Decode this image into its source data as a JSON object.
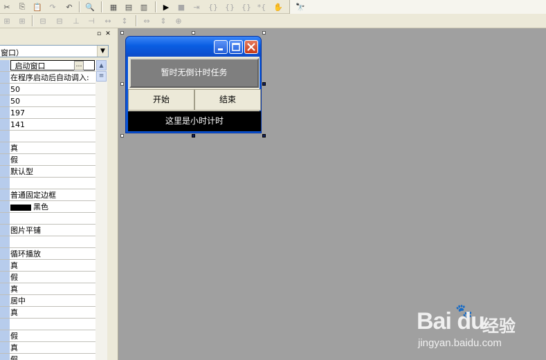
{
  "toolbar": {
    "row1_icons": [
      "cut-icon",
      "copy-icon",
      "paste-icon",
      "redo-icon",
      "undo-icon",
      "find-icon",
      "layout-a-icon",
      "layout-b-icon",
      "layout-c-icon",
      "run-icon",
      "stop-icon",
      "step-icon",
      "step-into-icon",
      "step-over-icon",
      "step-out-icon",
      "run-to-icon",
      "hand-icon",
      "search-binoculars-icon"
    ],
    "row2_icons": [
      "align-left-icon",
      "align-right-icon",
      "align-top-icon",
      "align-bottom-icon",
      "center-h-icon",
      "center-v-icon",
      "space-h-icon",
      "space-v-icon",
      "same-width-icon",
      "same-height-icon",
      "same-size-icon"
    ]
  },
  "panel": {
    "combo_value": "窗口）",
    "rows": [
      {
        "value": "_启动窗口",
        "selected": true
      },
      {
        "value": "在程序启动后自动调入:"
      },
      {
        "value": "50"
      },
      {
        "value": "50"
      },
      {
        "value": "197"
      },
      {
        "value": "141"
      },
      {
        "value": ""
      },
      {
        "value": "真"
      },
      {
        "value": "假"
      },
      {
        "value": "默认型"
      },
      {
        "value": ""
      },
      {
        "value": "普通固定边框"
      },
      {
        "value": "黑色",
        "swatch": "#000000"
      },
      {
        "value": ""
      },
      {
        "value": "图片平铺"
      },
      {
        "value": ""
      },
      {
        "value": "循环播放"
      },
      {
        "value": "真"
      },
      {
        "value": "假"
      },
      {
        "value": "真"
      },
      {
        "value": "居中"
      },
      {
        "value": "真"
      },
      {
        "value": ""
      },
      {
        "value": "假"
      },
      {
        "value": "真"
      },
      {
        "value": "假"
      }
    ]
  },
  "form": {
    "task_label": "暂时无倒计时任务",
    "start_button": "开始",
    "end_button": "结束",
    "timer_label": "这里是小时计时"
  },
  "watermark": {
    "logo": "Bai du",
    "logo_cn": "经验",
    "url": "jingyan.baidu.com"
  },
  "colors": {
    "title_bar": "#0a5ee3",
    "task_label_bg": "#7f7f7f",
    "timer_label_bg": "#000000",
    "design_bg": "#a0a0a0"
  }
}
